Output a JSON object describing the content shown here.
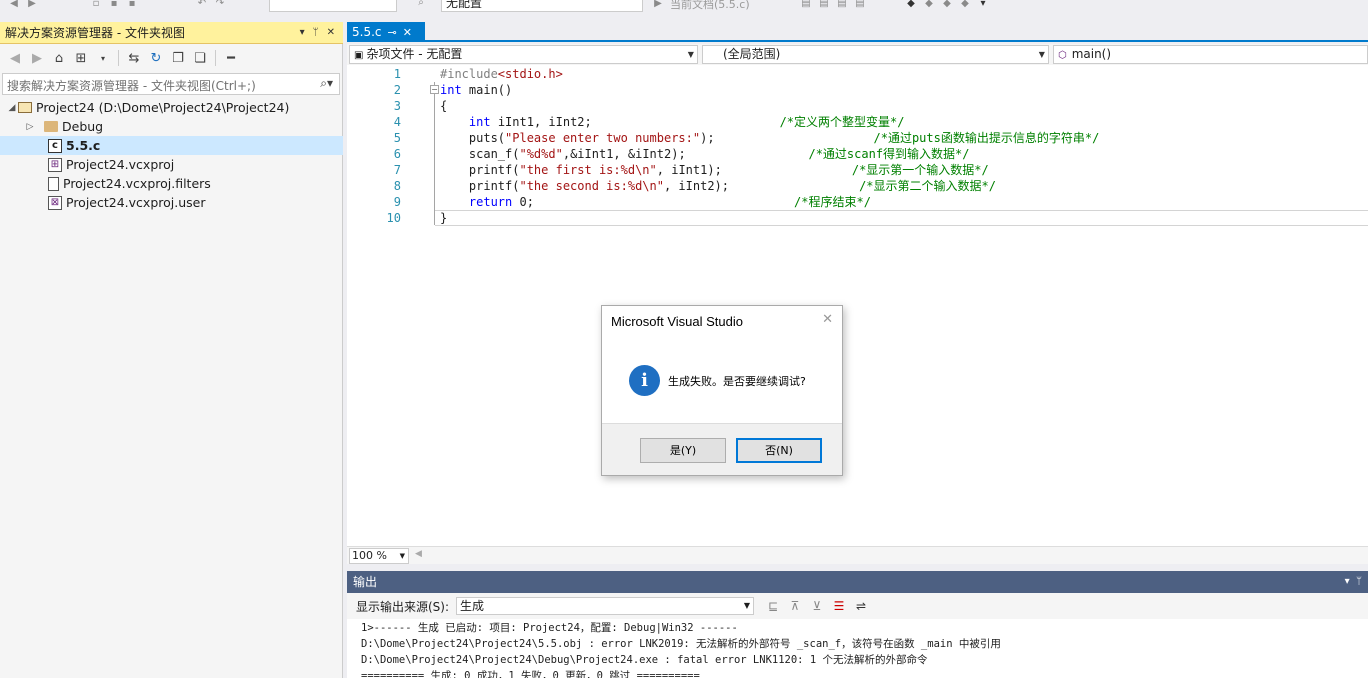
{
  "toolbar": {
    "config_combo": "无配置",
    "current_doc_combo": "当前文档(5.5.c)"
  },
  "solution_explorer": {
    "title": "解决方案资源管理器 - 文件夹视图",
    "search_placeholder": "搜索解决方案资源管理器 - 文件夹视图(Ctrl+;)",
    "tree": [
      {
        "label": "Project24 (D:\\Dome\\Project24\\Project24)",
        "icon": "solution-folder-icon",
        "level": 0,
        "expanded": true
      },
      {
        "label": "Debug",
        "icon": "folder-icon",
        "level": 1,
        "expanded": false
      },
      {
        "label": "5.5.c",
        "icon": "c-file-icon",
        "level": 1,
        "selected": true
      },
      {
        "label": "Project24.vcxproj",
        "icon": "vcxproj-file-icon",
        "level": 1
      },
      {
        "label": "Project24.vcxproj.filters",
        "icon": "document-icon",
        "level": 1
      },
      {
        "label": "Project24.vcxproj.user",
        "icon": "user-file-icon",
        "level": 1
      }
    ]
  },
  "editor": {
    "tab_label": "5.5.c",
    "nav": {
      "project": "杂项文件 - 无配置",
      "scope": "(全局范围)",
      "member": "main()"
    },
    "zoom": "100 %",
    "lines": [
      {
        "num": "1",
        "parts": [
          {
            "t": "#include",
            "c": "pp"
          },
          {
            "t": "<stdio.h>",
            "c": "str"
          }
        ]
      },
      {
        "num": "2",
        "parts": [
          {
            "t": "int",
            "c": "kw"
          },
          {
            "t": " main()",
            "c": ""
          }
        ]
      },
      {
        "num": "3",
        "parts": [
          {
            "t": "{",
            "c": ""
          }
        ]
      },
      {
        "num": "4",
        "parts": [
          {
            "t": "    ",
            "c": ""
          },
          {
            "t": "int",
            "c": "kw"
          },
          {
            "t": " iInt1, iInt2;                          ",
            "c": ""
          },
          {
            "t": "/*定义两个整型变量*/",
            "c": "cmt"
          }
        ]
      },
      {
        "num": "5",
        "parts": [
          {
            "t": "    puts(",
            "c": ""
          },
          {
            "t": "\"Please enter two numbers:\"",
            "c": "str"
          },
          {
            "t": ");                      ",
            "c": ""
          },
          {
            "t": "/*通过puts函数输出提示信息的字符串*/",
            "c": "cmt"
          }
        ]
      },
      {
        "num": "6",
        "parts": [
          {
            "t": "    scan_f(",
            "c": ""
          },
          {
            "t": "\"%d%d\"",
            "c": "str"
          },
          {
            "t": ",&iInt1, &iInt2);                 ",
            "c": ""
          },
          {
            "t": "/*通过scanf得到输入数据*/",
            "c": "cmt"
          }
        ]
      },
      {
        "num": "7",
        "parts": [
          {
            "t": "    printf(",
            "c": ""
          },
          {
            "t": "\"the first is:%d\\n\"",
            "c": "str"
          },
          {
            "t": ", iInt1);                  ",
            "c": ""
          },
          {
            "t": "/*显示第一个输入数据*/",
            "c": "cmt"
          }
        ]
      },
      {
        "num": "8",
        "parts": [
          {
            "t": "    printf(",
            "c": ""
          },
          {
            "t": "\"the second is:%d\\n\"",
            "c": "str"
          },
          {
            "t": ", iInt2);                  ",
            "c": ""
          },
          {
            "t": "/*显示第二个输入数据*/",
            "c": "cmt"
          }
        ]
      },
      {
        "num": "9",
        "parts": [
          {
            "t": "    ",
            "c": ""
          },
          {
            "t": "return",
            "c": "kw"
          },
          {
            "t": " 0;                                    ",
            "c": ""
          },
          {
            "t": "/*程序结束*/",
            "c": "cmt"
          }
        ]
      },
      {
        "num": "10",
        "parts": [
          {
            "t": "}",
            "c": ""
          }
        ]
      }
    ]
  },
  "output": {
    "title": "输出",
    "source_label": "显示输出来源(S):",
    "source_value": "生成",
    "lines": [
      "1>------ 生成 已启动: 项目: Project24，配置: Debug|Win32 ------",
      "D:\\Dome\\Project24\\Project24\\5.5.obj : error LNK2019: 无法解析的外部符号 _scan_f，该符号在函数 _main 中被引用",
      "D:\\Dome\\Project24\\Project24\\Debug\\Project24.exe : fatal error LNK1120: 1 个无法解析的外部命令",
      "========== 生成: 0 成功，1 失败，0 更新，0 跳过 =========="
    ]
  },
  "dialog": {
    "title": "Microsoft Visual Studio",
    "message": "生成失败。是否要继续调试?",
    "yes_label": "是(Y)",
    "no_label": "否(N)"
  },
  "colors": {
    "accent": "#007acc",
    "panel_title_active": "#fff29d",
    "output_title": "#4d6082",
    "keyword": "#0000ff",
    "string": "#a31515",
    "comment": "#008000"
  }
}
